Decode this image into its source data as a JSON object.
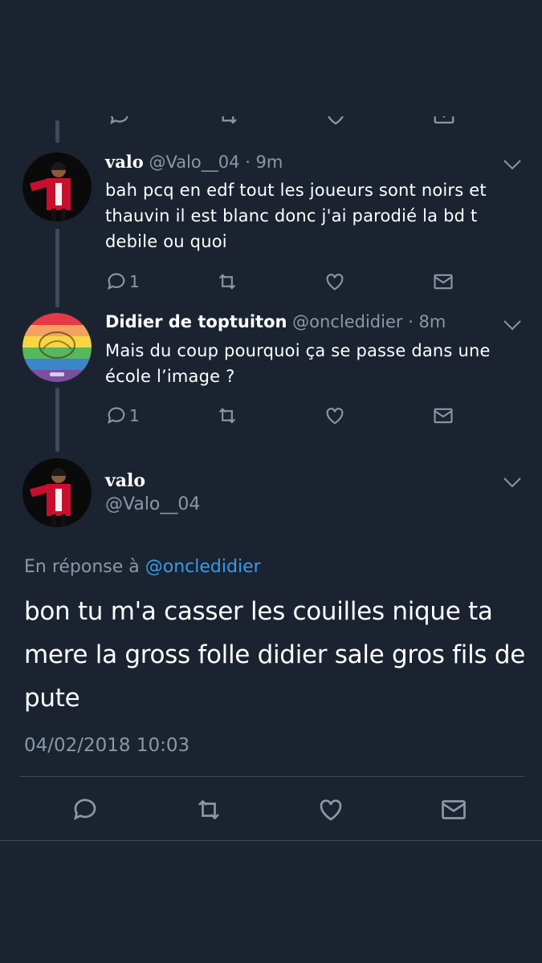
{
  "colors": {
    "background": "#1b2330",
    "muted": "#8899a6",
    "link": "#3a9ae8",
    "line": "#3d4a5c"
  },
  "tweets": [
    {
      "name": "valo",
      "handle": "@Valo__04",
      "time": "· 9m",
      "text": "bah pcq en edf tout les joueurs sont noirs et thauvin il est blanc donc j'ai parodié la bd t debile ou quoi",
      "reply_count": "1"
    },
    {
      "name": "Didier de toptuiton",
      "handle": "@oncledidier",
      "time": "· 8m",
      "text": "Mais du coup pourquoi ça se passe dans une école l’image ?",
      "reply_count": "1"
    }
  ],
  "focus": {
    "name": "valo",
    "handle": "@Valo__04",
    "reply_prefix": "En réponse à",
    "reply_link": "@oncledidier",
    "text": "bon tu m'a casser les couilles nique ta mere la gross folle didier sale gros fils de pute",
    "timestamp": "04/02/2018 10:03"
  },
  "icons": [
    "reply-icon",
    "retweet-icon",
    "like-icon",
    "message-icon",
    "chevron-down-icon"
  ]
}
